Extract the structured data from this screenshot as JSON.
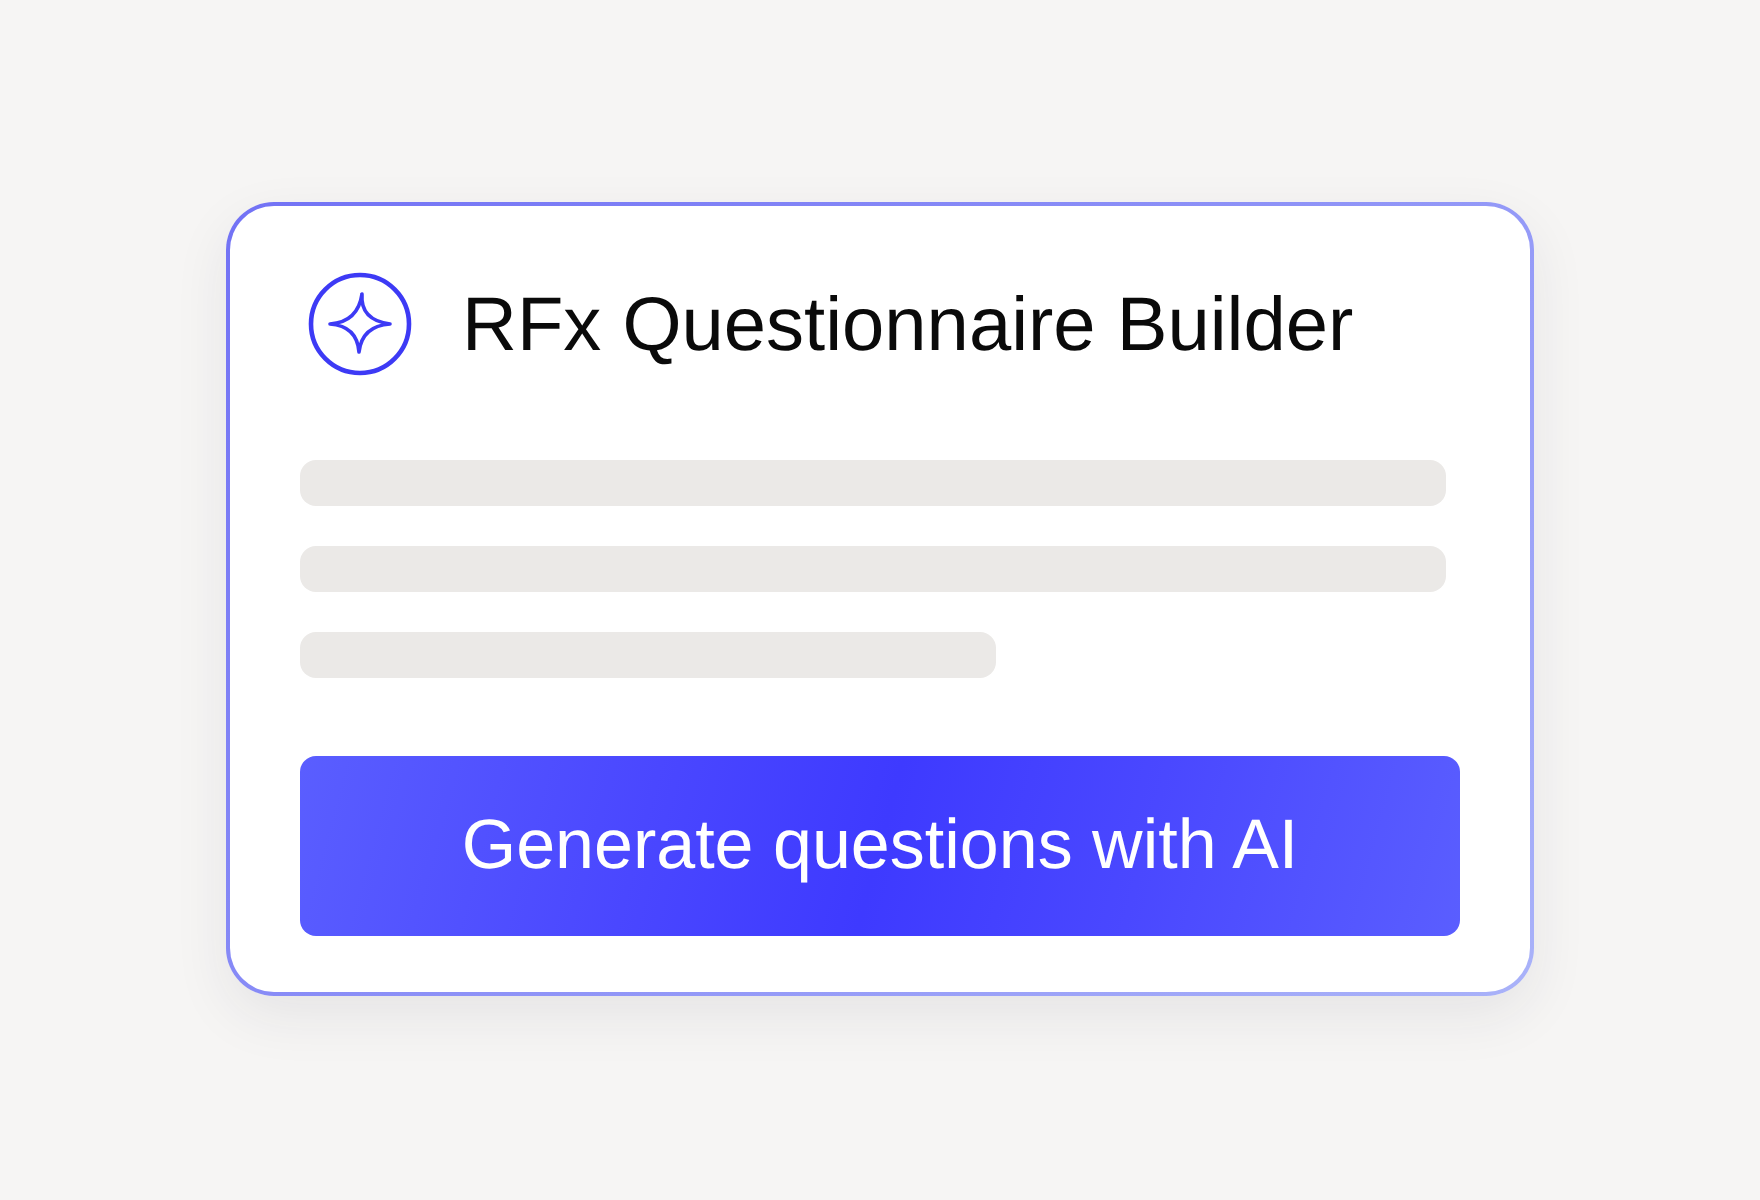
{
  "card": {
    "title": "RFx Questionnaire Builder",
    "button": {
      "label": "Generate questions with AI"
    }
  }
}
